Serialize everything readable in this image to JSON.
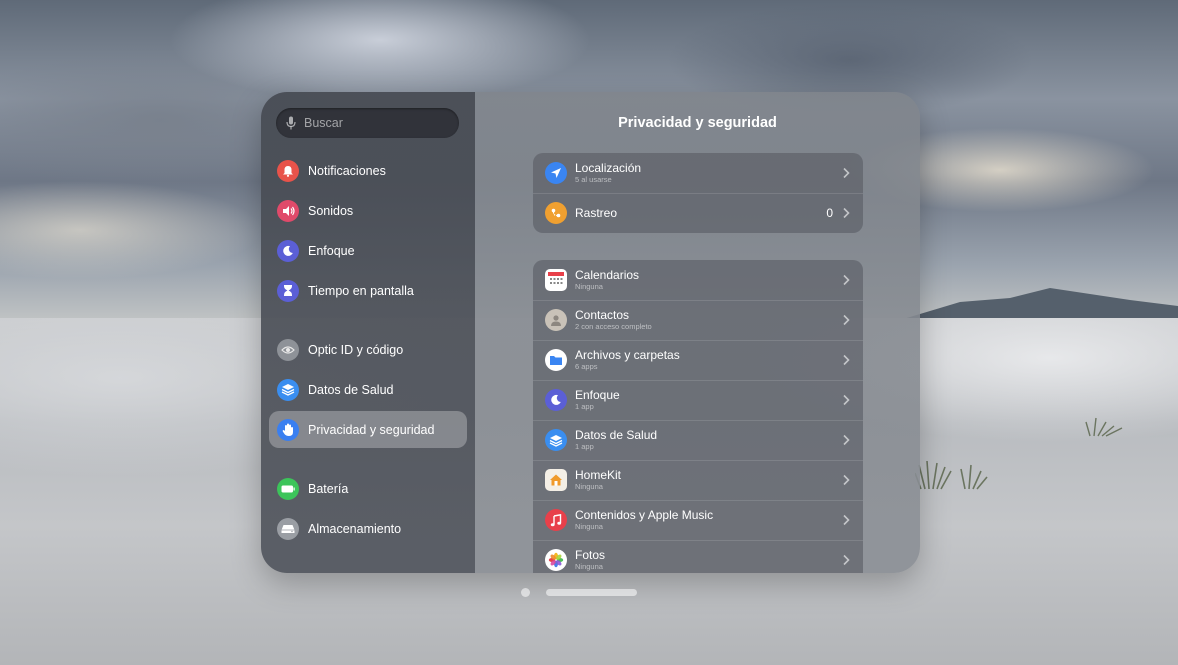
{
  "search": {
    "placeholder": "Buscar"
  },
  "sidebar": {
    "items": [
      {
        "label": "Notificaciones",
        "icon": "bell-icon",
        "color": "#e8534a"
      },
      {
        "label": "Sonidos",
        "icon": "speaker-icon",
        "color": "#e04a6a"
      },
      {
        "label": "Enfoque",
        "icon": "moon-icon",
        "color": "#5b5fd6"
      },
      {
        "label": "Tiempo en pantalla",
        "icon": "hourglass-icon",
        "color": "#5b5fd6"
      },
      {
        "label": "Optic ID y código",
        "icon": "eye-icon",
        "color": "#8e9298"
      },
      {
        "label": "Datos de Salud",
        "icon": "health-stack-icon",
        "color": "#3a8ef0"
      },
      {
        "label": "Privacidad y seguridad",
        "icon": "hand-icon",
        "color": "#3a7ff0",
        "selected": true
      },
      {
        "label": "Batería",
        "icon": "battery-icon",
        "color": "#3cc45a"
      },
      {
        "label": "Almacenamiento",
        "icon": "drive-icon",
        "color": "#9a9ea4"
      }
    ]
  },
  "main": {
    "title": "Privacidad y seguridad",
    "group1": [
      {
        "label": "Localización",
        "sub": "5 al usarse",
        "icon": "location-arrow-icon",
        "color": "#3a85f2"
      },
      {
        "label": "Rastreo",
        "sub": "",
        "value": "0",
        "icon": "tracking-icon",
        "color": "#f0a030"
      }
    ],
    "group2": [
      {
        "label": "Calendarios",
        "sub": "Ninguna",
        "icon": "calendar-icon",
        "color": "#ffffff"
      },
      {
        "label": "Contactos",
        "sub": "2 con acceso completo",
        "icon": "contacts-icon",
        "color": "#c9c2b8"
      },
      {
        "label": "Archivos y carpetas",
        "sub": "6 apps",
        "icon": "folder-icon",
        "color": "#3a85f2"
      },
      {
        "label": "Enfoque",
        "sub": "1 app",
        "icon": "moon-icon",
        "color": "#5b5fd6"
      },
      {
        "label": "Datos de Salud",
        "sub": "1 app",
        "icon": "health-stack-icon",
        "color": "#3a8ef0"
      },
      {
        "label": "HomeKit",
        "sub": "Ninguna",
        "icon": "home-icon",
        "color": "#f4efe6"
      },
      {
        "label": "Contenidos y Apple Music",
        "sub": "Ninguna",
        "icon": "music-note-icon",
        "color": "#e8404a"
      },
      {
        "label": "Fotos",
        "sub": "Ninguna",
        "icon": "photos-icon",
        "color": "#ffffff"
      }
    ]
  }
}
